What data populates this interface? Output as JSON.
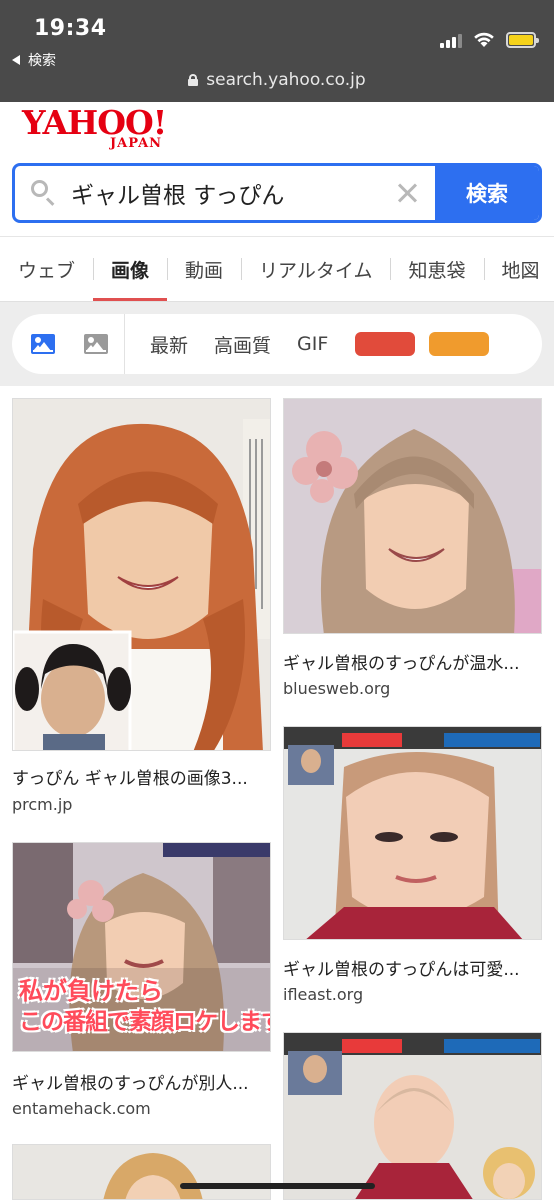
{
  "status_bar": {
    "time": "19:34",
    "back_label": "検索",
    "url": "search.yahoo.co.jp"
  },
  "logo": {
    "main": "YAHOO!",
    "sub": "JAPAN"
  },
  "search": {
    "query": "ギャル曽根 すっぴん",
    "button_label": "検索"
  },
  "tabs": [
    {
      "label": "ウェブ"
    },
    {
      "label": "画像"
    },
    {
      "label": "動画"
    },
    {
      "label": "リアルタイム"
    },
    {
      "label": "知恵袋"
    },
    {
      "label": "地図"
    }
  ],
  "filters": {
    "latest": "最新",
    "hq": "高画質",
    "gif": "GIF",
    "color_red": "#e14b3b",
    "color_orange": "#f09b2d"
  },
  "results": [
    {
      "title": "すっぴん ギャル曽根の画像3...",
      "domain": "prcm.jp"
    },
    {
      "title": "ギャル曽根のすっぴんが温水...",
      "domain": "bluesweb.org"
    },
    {
      "title": "ギャル曽根のすっぴんは可愛...",
      "domain": "ifleast.org"
    },
    {
      "title": "ギャル曽根のすっぴんが別人...",
      "domain": "entamehack.com",
      "overlay_1": "私が負けたら",
      "overlay_2": "この番組で素顔ロケします!"
    }
  ],
  "colors": {
    "accent": "#2d6ff0",
    "brand": "#e50012",
    "active_tab": "#e05050"
  }
}
